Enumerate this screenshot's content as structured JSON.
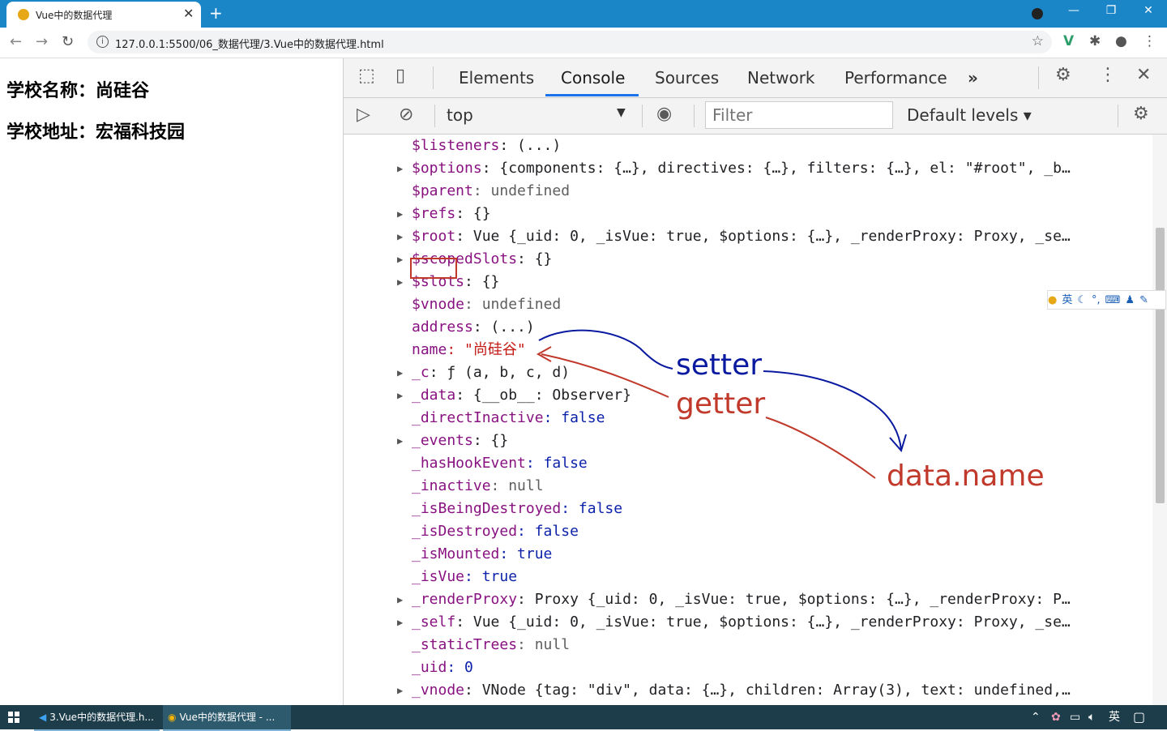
{
  "browser": {
    "tab_title": "Vue中的数据代理",
    "tab_close": "✕",
    "new_tab": "+",
    "url": "127.0.0.1:5500/06_数据代理/3.Vue中的数据代理.html"
  },
  "page": {
    "line1": "学校名称：尚硅谷",
    "line2": "学校地址：宏福科技园"
  },
  "devtools": {
    "tabs": [
      "Elements",
      "Console",
      "Sources",
      "Network",
      "Performance"
    ],
    "more_tabs": "»",
    "context": "top",
    "filter_placeholder": "Filter",
    "levels": "Default levels ▾",
    "rows": [
      {
        "arrow": false,
        "key": "$listeners",
        "val": ": (...)"
      },
      {
        "arrow": true,
        "key": "$options",
        "val": ": {components: {…}, directives: {…}, filters: {…}, el: \"#root\", _b…"
      },
      {
        "arrow": false,
        "key": "$parent",
        "val": ": undefined"
      },
      {
        "arrow": true,
        "key": "$refs",
        "val": ": {}"
      },
      {
        "arrow": true,
        "key": "$root",
        "val": ": Vue {_uid: 0, _isVue: true, $options: {…}, _renderProxy: Proxy, _se…"
      },
      {
        "arrow": true,
        "key": "$scopedSlots",
        "val": ": {}"
      },
      {
        "arrow": true,
        "key": "$slots",
        "val": ": {}"
      },
      {
        "arrow": false,
        "key": "$vnode",
        "val": ": undefined"
      },
      {
        "arrow": false,
        "key": "address",
        "val": ": (...)"
      },
      {
        "arrow": false,
        "key": "name",
        "val": ": \"尚硅谷\""
      },
      {
        "arrow": true,
        "key": "_c",
        "val": ": ƒ (a, b, c, d)"
      },
      {
        "arrow": true,
        "key": "_data",
        "val": ": {__ob__: Observer}"
      },
      {
        "arrow": false,
        "key": "_directInactive",
        "val": ": false"
      },
      {
        "arrow": true,
        "key": "_events",
        "val": ": {}"
      },
      {
        "arrow": false,
        "key": "_hasHookEvent",
        "val": ": false"
      },
      {
        "arrow": false,
        "key": "_inactive",
        "val": ": null"
      },
      {
        "arrow": false,
        "key": "_isBeingDestroyed",
        "val": ": false"
      },
      {
        "arrow": false,
        "key": "_isDestroyed",
        "val": ": false"
      },
      {
        "arrow": false,
        "key": "_isMounted",
        "val": ": true"
      },
      {
        "arrow": false,
        "key": "_isVue",
        "val": ": true"
      },
      {
        "arrow": true,
        "key": "_renderProxy",
        "val": ": Proxy {_uid: 0, _isVue: true, $options: {…}, _renderProxy: P…"
      },
      {
        "arrow": true,
        "key": "_self",
        "val": ": Vue {_uid: 0, _isVue: true, $options: {…}, _renderProxy: Proxy, _se…"
      },
      {
        "arrow": false,
        "key": "_staticTrees",
        "val": ": null"
      },
      {
        "arrow": false,
        "key": "_uid",
        "val": ": 0"
      },
      {
        "arrow": true,
        "key": "_vnode",
        "val": ": VNode {tag: \"div\", data: {…}, children: Array(3), text: undefined,…"
      }
    ]
  },
  "annotations": {
    "setter": "setter",
    "getter": "getter",
    "data_name": "data.name",
    "setter_color": "#0a1aa0",
    "getter_color": "#c0392b"
  },
  "ime": {
    "label": "英"
  },
  "taskbar": {
    "vscode": "3.Vue中的数据代理.h...",
    "chrome": "Vue中的数据代理 - ...",
    "ime": "英"
  }
}
